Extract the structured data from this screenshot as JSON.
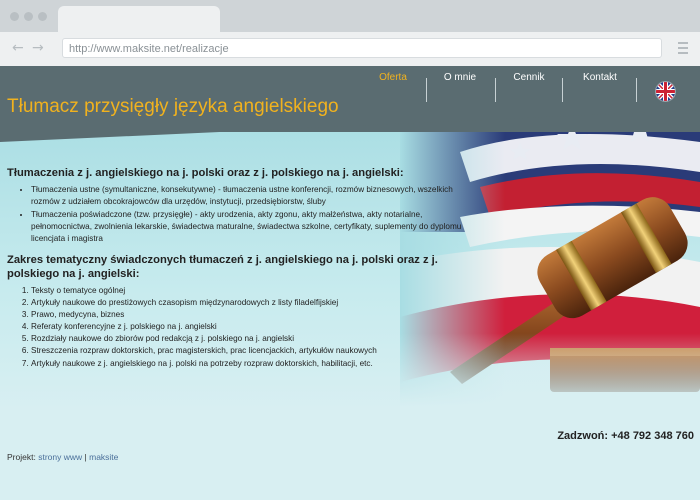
{
  "browser": {
    "url": "http://www.maksite.net/realizacje",
    "back_icon": "arrow-left-icon",
    "forward_icon": "arrow-right-icon"
  },
  "site": {
    "title": "Tłumacz przysięgły języka angielskiego",
    "nav": [
      {
        "label": "Oferta",
        "active": true
      },
      {
        "label": "O mnie",
        "active": false
      },
      {
        "label": "Cennik",
        "active": false
      },
      {
        "label": "Kontakt",
        "active": false
      }
    ],
    "flag_icon": "uk-flag-icon"
  },
  "content": {
    "section1": {
      "heading": "Tłumaczenia z j. angielskiego na j. polski oraz z j. polskiego na j. angielski:",
      "items": [
        "Tłumaczenia ustne (symultaniczne, konsekutywne) - tłumaczenia ustne konferencji, rozmów biznesowych, wszelkich rozmów z udziałem obcokrajowców dla urzędów, instytucji, przedsiębiorstw, śluby",
        "Tłumaczenia poświadczone (tzw. przysięgłe) - akty urodzenia, akty zgonu, akty małżeństwa, akty notarialne, pełnomocnictwa, zwolnienia lekarskie, świadectwa maturalne, świadectwa szkolne, certyfikaty, suplementy do dyplomu licencjata i magistra"
      ]
    },
    "section2": {
      "heading": "Zakres tematyczny świadczonych tłumaczeń z j. angielskiego na j. polski oraz z j. polskiego na j. angielski:",
      "items": [
        "Teksty o tematyce ogólnej",
        "Artykuły naukowe do prestiżowych czasopism międzynarodowych z listy filadelfijskiej",
        "Prawo, medycyna, biznes",
        "Referaty konferencyjne z j. polskiego na j. angielski",
        "Rozdziały naukowe do zbiorów pod redakcją z j. polskiego na j. angielski",
        "Streszczenia rozpraw doktorskich, prac magisterskich, prac licencjackich, artykułów naukowych",
        "Artykuły naukowe z j. angielskiego na j. polski na potrzeby rozpraw doktorskich, habilitacji, etc."
      ]
    }
  },
  "contact": {
    "phone": "Zadzwoń: +48 792 348 760"
  },
  "footer": {
    "label": "Projekt:",
    "link1": "strony www",
    "sep": "|",
    "link2": "maksite"
  }
}
